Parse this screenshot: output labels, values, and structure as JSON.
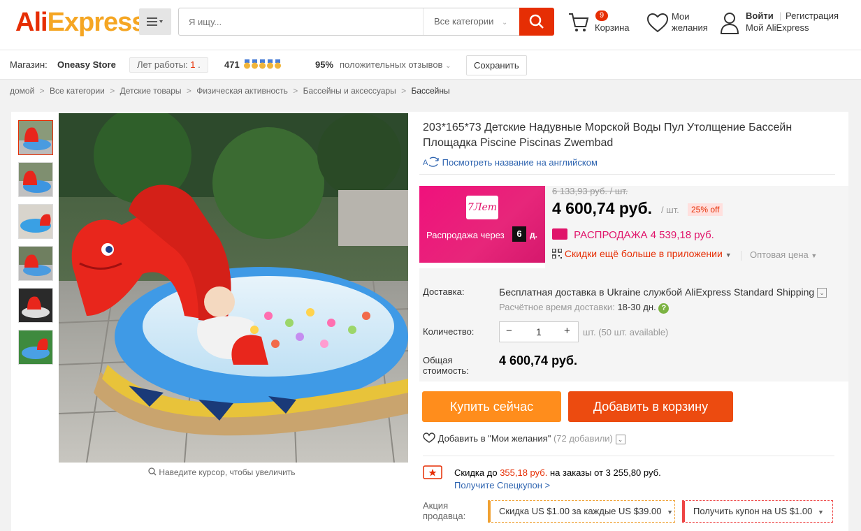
{
  "header": {
    "logo_part1": "Ali",
    "logo_part2": "Express",
    "logo_tm": "®",
    "search_placeholder": "Я ищу...",
    "search_category": "Все категории",
    "cart_count": "9",
    "cart_label": "Корзина",
    "wishlist_label": "Мои желания",
    "login": "Войти",
    "register": "Регистрация",
    "my_account": "Мой AliExpress"
  },
  "store": {
    "label": "Магазин:",
    "name": "Oneasy Store",
    "years_label": "Лет работы:",
    "years_value": "1",
    "years_suffix": ".",
    "feedback_score": "471",
    "positive_pct": "95%",
    "positive_label": "положительных отзывов",
    "save_label": "Сохранить"
  },
  "breadcrumb": [
    "домой",
    ">",
    "Все категории",
    ">",
    "Детские товары",
    ">",
    "Физическая активность",
    ">",
    "Бассейны и аксессуары",
    ">",
    "Бассейны"
  ],
  "product": {
    "title": "203*165*73 Детские Надувные Морской Воды Пул Утолщение Бассейн Площадка Piscine Piscinas Zwembad",
    "translate_link": "Посмотреть название на английском",
    "zoom_hint": "Наведите курсор, чтобы увеличить",
    "thumbnails": 6
  },
  "promo": {
    "logo_text": "7Лет",
    "sale_in": "Распродажа через",
    "days": "6",
    "days_unit": "д."
  },
  "price": {
    "old": "6 133,93 руб. / шт.",
    "current": "4 600,74 руб.",
    "unit": "/ шт.",
    "discount": "25% off",
    "sale_label": "РАСПРОДАЖА",
    "sale_price": "4 539,18 руб.",
    "app_discount": "Скидки ещё больше в приложении",
    "wholesale": "Оптовая цена"
  },
  "shipping": {
    "label": "Доставка:",
    "value": "Бесплатная доставка в Ukraine службой AliExpress Standard Shipping",
    "eta_label": "Расчётное время доставки:",
    "eta_value": "18-30 дн."
  },
  "quantity": {
    "label": "Количество:",
    "value": "1",
    "minus": "−",
    "plus": "+",
    "available": "шт. (50 шт. available)"
  },
  "total": {
    "label": "Общая стоимость:",
    "value": "4 600,74 руб."
  },
  "actions": {
    "buy_now": "Купить сейчас",
    "add_to_cart": "Добавить в корзину",
    "add_wish": "Добавить в \"Мои желания\"",
    "wish_count": "(72 добавили)"
  },
  "coupon": {
    "prefix": "Скидка до",
    "amount": "355,18 руб.",
    "suffix": "на заказы от 3 255,80 руб.",
    "link": "Получите Спецкупон >"
  },
  "seller_promo": {
    "label": "Акция продавца:",
    "tag1": "Скидка US $1.00 за каждые US $39.00",
    "tag2": "Получить купон на US $1.00"
  },
  "colors": {
    "brand_red": "#e62e04",
    "buy_orange": "#ff8d1c",
    "cart_orange": "#ec4b10",
    "promo_pink": "#e0146a",
    "link_blue": "#2e64b0"
  }
}
